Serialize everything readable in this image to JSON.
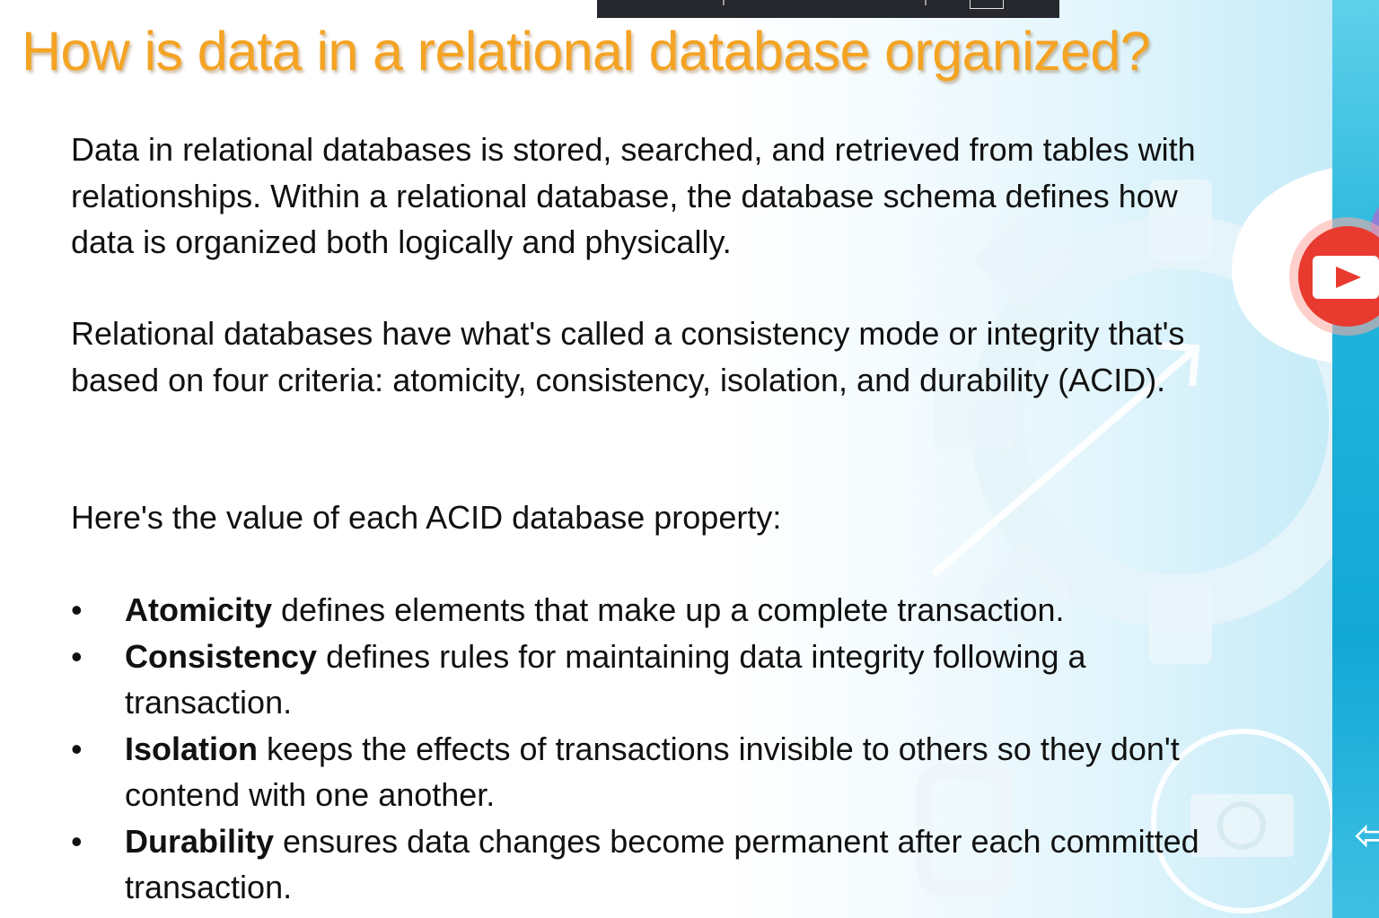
{
  "slide": {
    "title": "How is data in a relational database organized?",
    "paragraphs": [
      "Data in relational databases is stored, searched, and retrieved from tables with relationships. Within a relational database, the database schema defines how data is organized both logically and physically.",
      "Relational databases have what's called a consistency mode or integrity that's based on four criteria: atomicity, consistency, isolation, and durability (ACID).",
      "Here's the value of each ACID database property:"
    ],
    "acid_properties": [
      {
        "term": "Atomicity",
        "description": " defines elements that make up a complete transaction."
      },
      {
        "term": "Consistency",
        "description": " defines rules for maintaining data integrity following a transaction."
      },
      {
        "term": "Isolation",
        "description": " keeps the effects of transactions invisible to others so they don't contend with one another."
      },
      {
        "term": "Durability",
        "description": " ensures data changes become permanent after each committed transaction."
      }
    ],
    "bullet_glyph": "•"
  },
  "decor": {
    "icons": [
      "gear-icon",
      "play-video-icon",
      "camera-icon",
      "left-arrow-icon",
      "fullscreen-icon"
    ],
    "colors": {
      "title": "#f4a323",
      "text": "#111111",
      "accent_blue": "#12a8d6",
      "play_red": "#e83a2f",
      "player_bar": "#26282d"
    },
    "arrow_glyph": "⇦"
  }
}
